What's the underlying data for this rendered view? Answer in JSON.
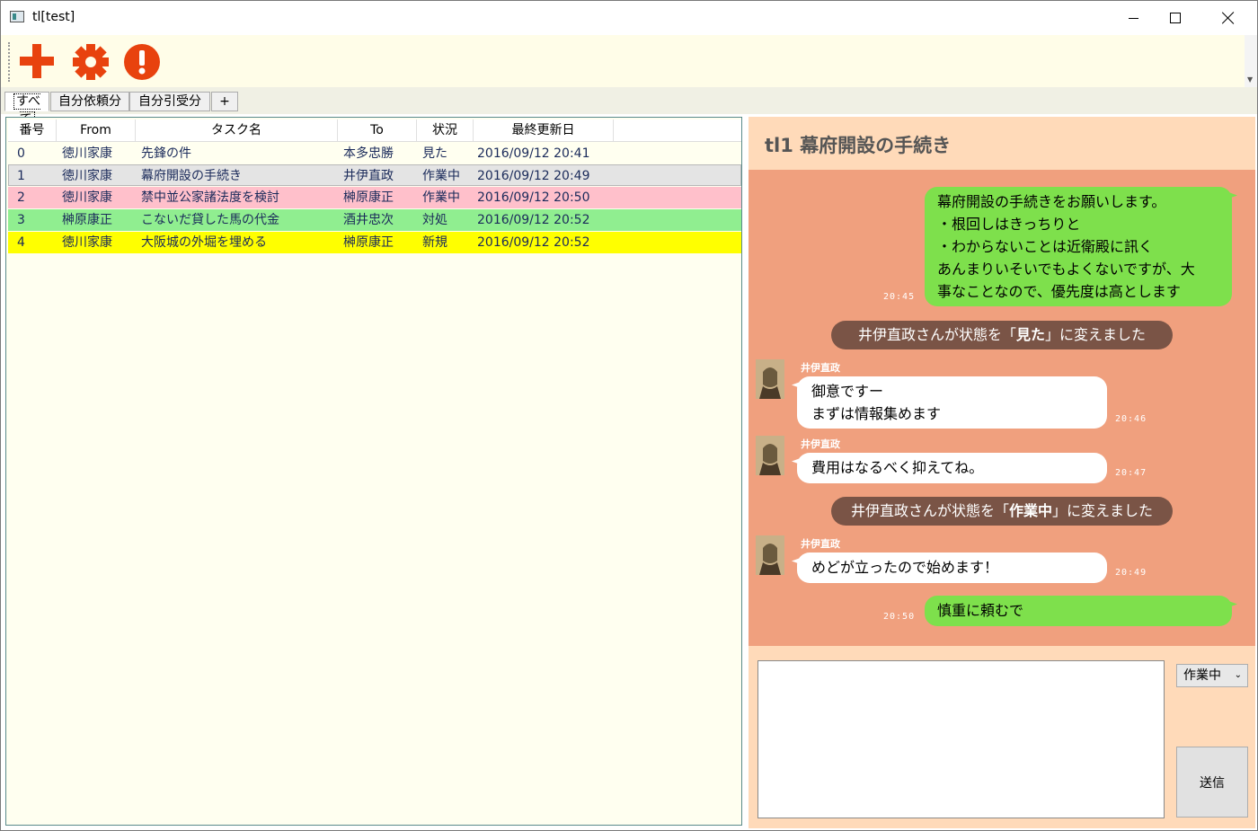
{
  "window": {
    "title": "tl[test]"
  },
  "toolbar": {
    "buttons": [
      {
        "icon": "plus-icon",
        "color": "#e8420e"
      },
      {
        "icon": "gear-icon",
        "color": "#e8420e"
      },
      {
        "icon": "exclamation-icon",
        "color": "#e8420e"
      }
    ]
  },
  "tabs": [
    "すべて",
    "自分依頼分",
    "自分引受分",
    "+"
  ],
  "table": {
    "columns": [
      "番号",
      "From",
      "タスク名",
      "To",
      "状況",
      "最終更新日"
    ],
    "rows": [
      {
        "no": "0",
        "from": "徳川家康",
        "task": "先鋒の件",
        "to": "本多忠勝",
        "status": "見た",
        "updated": "2016/09/12 20:41",
        "color": "#fffff0"
      },
      {
        "no": "1",
        "from": "徳川家康",
        "task": "幕府開設の手続き",
        "to": "井伊直政",
        "status": "作業中",
        "updated": "2016/09/12 20:49",
        "color": "#e4e4e4"
      },
      {
        "no": "2",
        "from": "徳川家康",
        "task": "禁中並公家諸法度を検討",
        "to": "榊原康正",
        "status": "作業中",
        "updated": "2016/09/12 20:50",
        "color": "#ffc0cb"
      },
      {
        "no": "3",
        "from": "榊原康正",
        "task": "こないだ貸した馬の代金",
        "to": "酒井忠次",
        "status": "対処",
        "updated": "2016/09/12 20:52",
        "color": "#90ee90"
      },
      {
        "no": "4",
        "from": "徳川家康",
        "task": "大阪城の外堀を埋める",
        "to": "榊原康正",
        "status": "新規",
        "updated": "2016/09/12 20:52",
        "color": "#ffff00"
      }
    ]
  },
  "detail": {
    "title": "tl1 幕府開設の手続き",
    "messages": {
      "m1": {
        "lines": [
          "幕府開設の手続きをお願いします。",
          "・根回しはきっちりと",
          "・わからないことは近衛殿に訊く",
          "あんまりいそいでもよくないですが、大",
          "事なことなので、優先度は高とします"
        ],
        "time": "20:45"
      },
      "s1": {
        "pre": "井伊直政さんが状態を「",
        "bold": "見た",
        "post": "」に変えました"
      },
      "m2": {
        "user": "井伊直政",
        "lines": [
          "御意ですー",
          "まずは情報集めます"
        ],
        "time": "20:46"
      },
      "m3": {
        "user": "井伊直政",
        "lines": [
          "費用はなるべく抑えてね。"
        ],
        "time": "20:47"
      },
      "s2": {
        "pre": "井伊直政さんが状態を「",
        "bold": "作業中",
        "post": "」に変えました"
      },
      "m4": {
        "user": "井伊直政",
        "lines": [
          "めどが立ったので始めます！"
        ],
        "time": "20:49"
      },
      "m5": {
        "lines": [
          "慎重に頼むで"
        ],
        "time": "20:50"
      }
    },
    "compose_value": "",
    "status_selected": "作業中",
    "send_label": "送信"
  },
  "colors": {
    "accent": "#e8420e",
    "chat_bg": "#f0a07e",
    "panel_bg": "#ffdab9",
    "bubble_out": "#7ee04c",
    "system_bubble": "#7a5446"
  }
}
